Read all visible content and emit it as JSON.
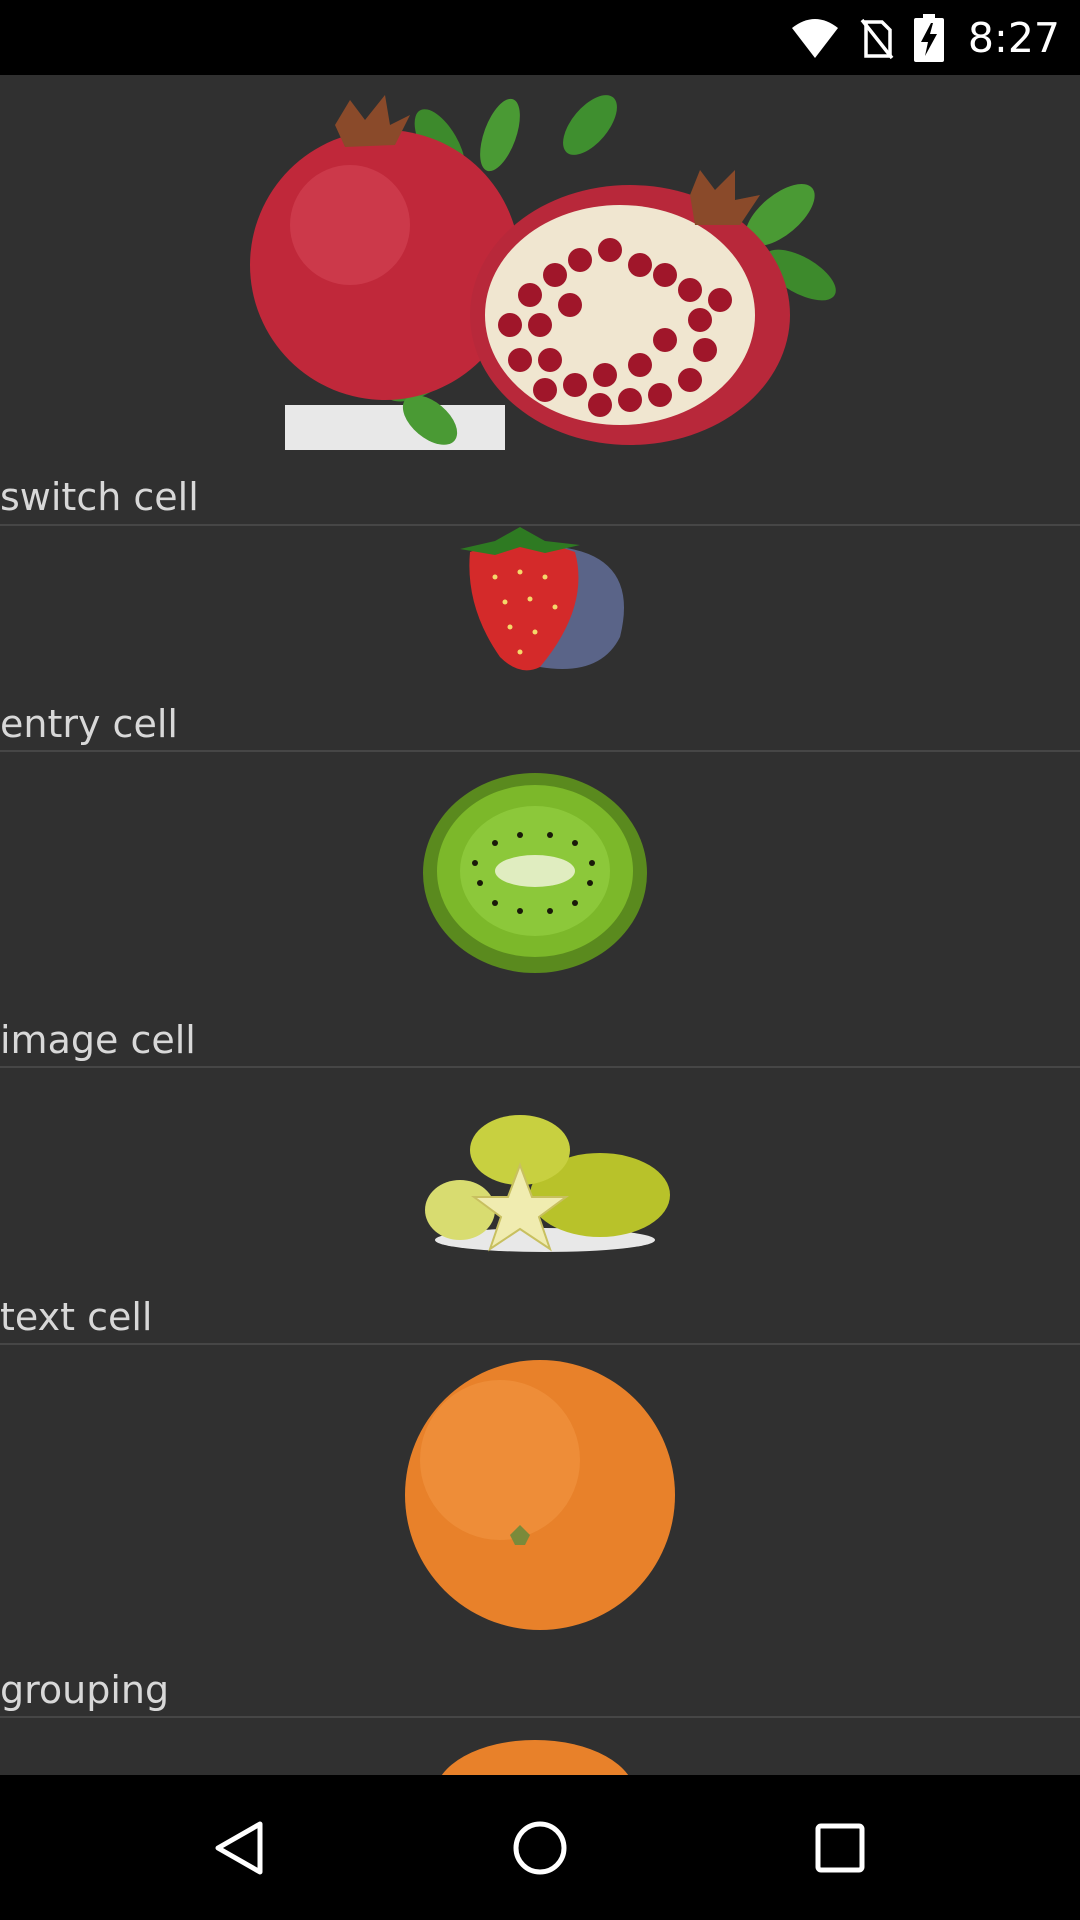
{
  "status_bar": {
    "time": "8:27",
    "icons": [
      "wifi-icon",
      "no-sim-icon",
      "battery-charging-icon"
    ]
  },
  "list": {
    "items": [
      {
        "label": "switch cell",
        "image": "pomegranate-image"
      },
      {
        "label": "entry cell",
        "image": "strawberry-image"
      },
      {
        "label": "image cell",
        "image": "kiwi-image"
      },
      {
        "label": "text cell",
        "image": "starfruit-image"
      },
      {
        "label": "grouping",
        "image": "orange-image"
      }
    ]
  },
  "nav_bar": {
    "buttons": [
      "back-icon",
      "home-icon",
      "recents-icon"
    ]
  },
  "colors": {
    "background": "#303030",
    "text": "#d8d8d8",
    "divider": "#464646",
    "bars": "#000000"
  }
}
